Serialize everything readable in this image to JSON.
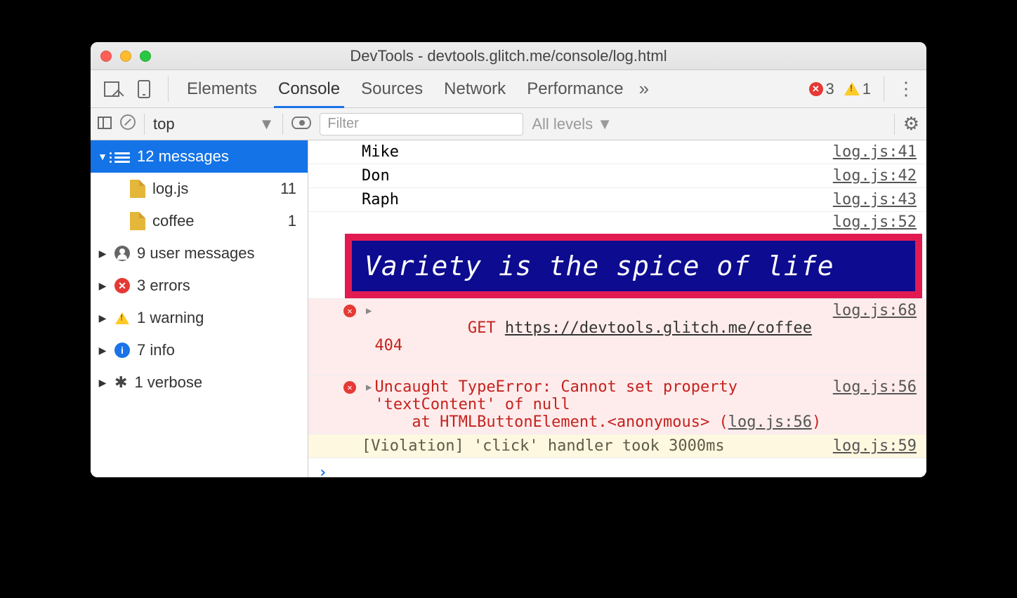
{
  "window": {
    "title": "DevTools - devtools.glitch.me/console/log.html"
  },
  "tabs": {
    "elements": "Elements",
    "console": "Console",
    "sources": "Sources",
    "network": "Network",
    "performance": "Performance",
    "overflow": "»",
    "errorCount": "3",
    "warnCount": "1"
  },
  "toolbar": {
    "context": "top",
    "filterPlaceholder": "Filter",
    "levels": "All levels"
  },
  "sidebar": {
    "messages": {
      "label": "12 messages"
    },
    "file1": {
      "label": "log.js",
      "count": "11"
    },
    "file2": {
      "label": "coffee",
      "count": "1"
    },
    "user": {
      "label": "9 user messages"
    },
    "errors": {
      "label": "3 errors"
    },
    "warn": {
      "label": "1 warning"
    },
    "info": {
      "label": "7 info"
    },
    "verbose": {
      "label": "1 verbose"
    }
  },
  "output": {
    "row1": {
      "text": "Mike",
      "src": "log.js:41"
    },
    "row2": {
      "text": "Don",
      "src": "log.js:42"
    },
    "row3": {
      "text": "Raph",
      "src": "log.js:43"
    },
    "bannerSrc": "log.js:52",
    "banner": "Variety is the spice of life",
    "err1": {
      "method": "GET",
      "url": "https://devtools.glitch.me/coffee",
      "code": "404",
      "src": "log.js:68"
    },
    "err2": {
      "line1": "Uncaught TypeError: Cannot set property ",
      "line2": "'textContent' of null",
      "line3": "    at HTMLButtonElement.<anonymous> (",
      "srcInline": "log.js:56",
      "tail": ")",
      "src": "log.js:56"
    },
    "warn": {
      "text": "[Violation] 'click' handler took 3000ms",
      "src": "log.js:59"
    },
    "prompt": "›"
  }
}
